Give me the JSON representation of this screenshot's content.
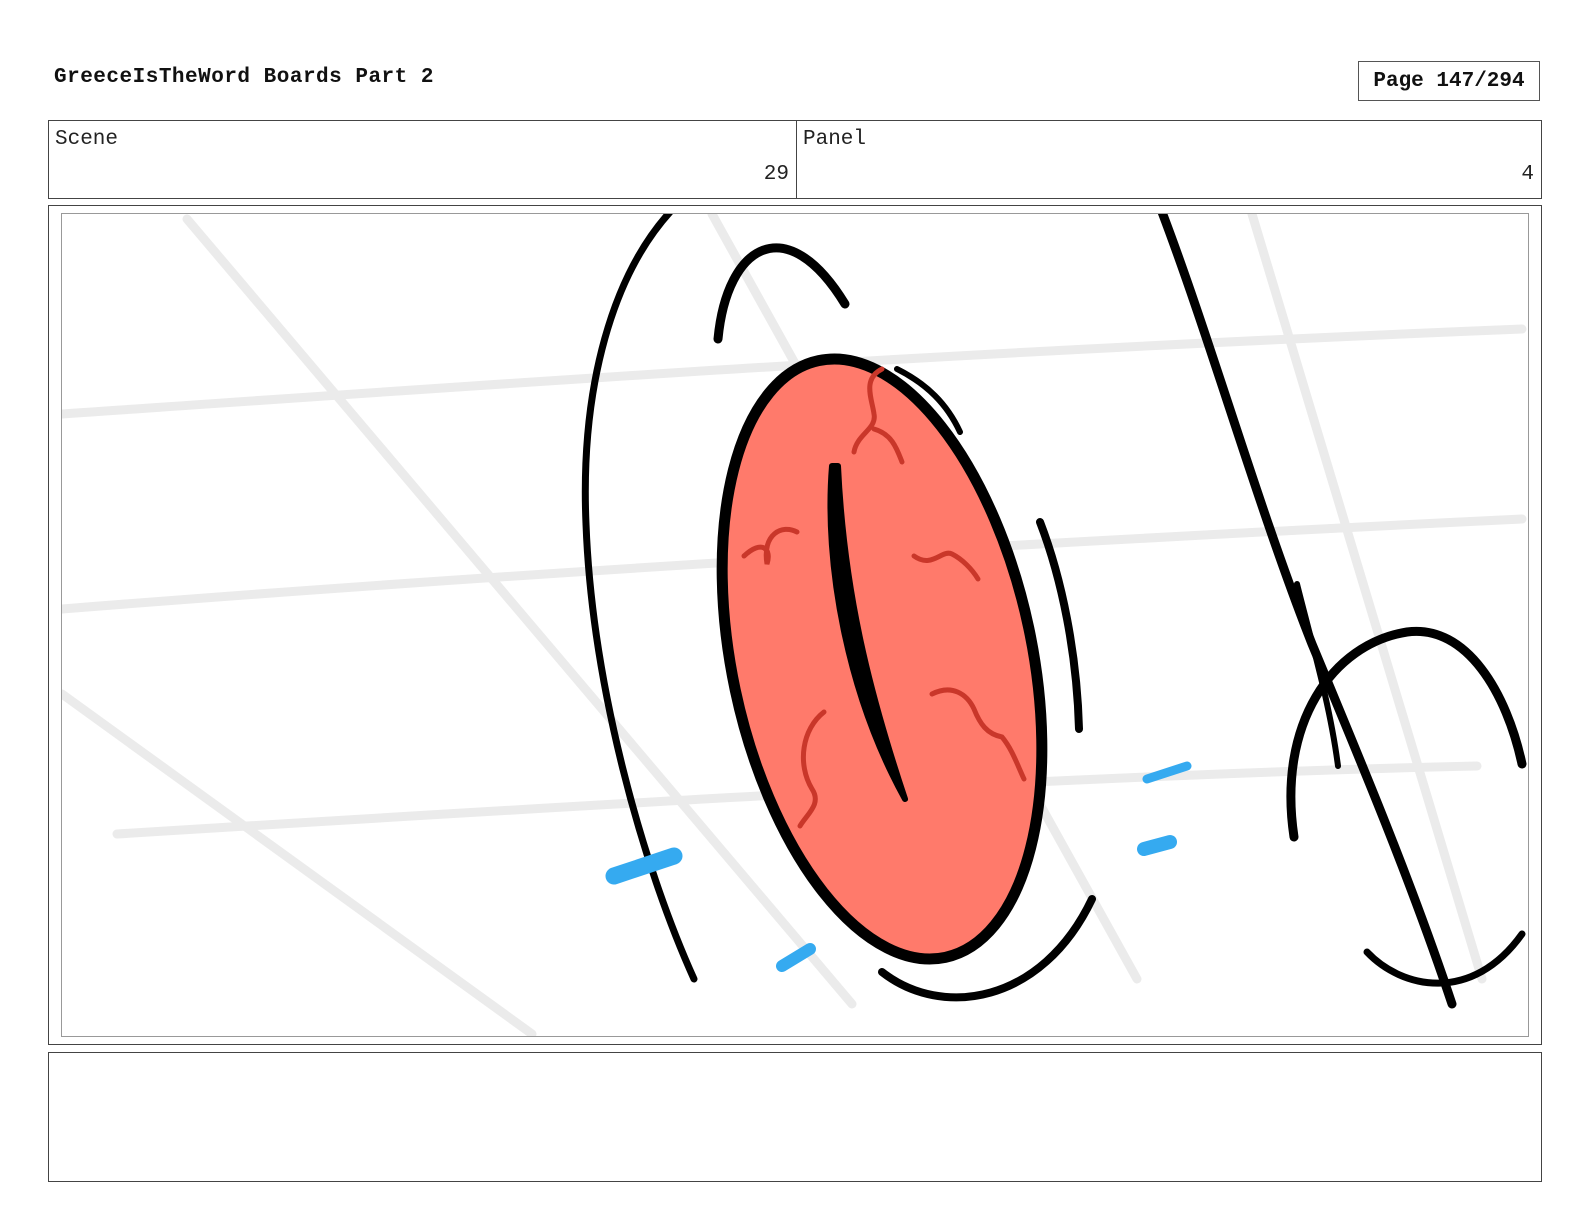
{
  "document": {
    "title": "GreeceIsTheWord Boards Part 2",
    "page_label": "Page 147/294"
  },
  "info": {
    "scene_label": "Scene",
    "scene_value": "29",
    "panel_label": "Panel",
    "panel_value": "4"
  },
  "artwork": {
    "description_icon": "eye-closeup-sketch-icon",
    "colors": {
      "ink": "#000000",
      "iris_fill": "#ff7a6b",
      "vein": "#c9372a",
      "accent": "#35aaf0",
      "guide": "#ebebeb"
    }
  },
  "notes": {
    "text": ""
  }
}
